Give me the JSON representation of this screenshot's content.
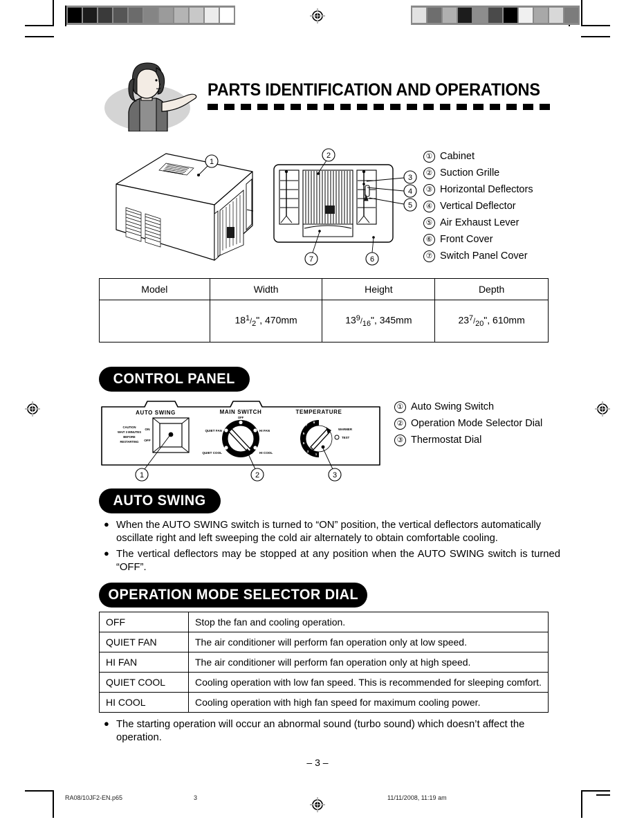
{
  "header": {
    "title": "PARTS IDENTIFICATION AND OPERATIONS",
    "illustration_alt": "woman-pointing-icon"
  },
  "parts_legend": [
    {
      "num": "①",
      "label": "Cabinet"
    },
    {
      "num": "②",
      "label": "Suction Grille"
    },
    {
      "num": "③",
      "label": "Horizontal Deflectors"
    },
    {
      "num": "④",
      "label": "Vertical Deflector"
    },
    {
      "num": "⑤",
      "label": "Air Exhaust Lever"
    },
    {
      "num": "⑥",
      "label": "Front Cover"
    },
    {
      "num": "⑦",
      "label": "Switch Panel Cover"
    }
  ],
  "dimension_table": {
    "headers": [
      "Model",
      "Width",
      "Height",
      "Depth"
    ],
    "row": {
      "model": "",
      "width_whole": "18",
      "width_num": "1",
      "width_den": "2",
      "width_mm": ", 470mm",
      "height_whole": "13",
      "height_num": "9",
      "height_den": "16",
      "height_mm": ", 345mm",
      "depth_whole": "23",
      "depth_num": "7",
      "depth_den": "20",
      "depth_mm": ", 610mm"
    }
  },
  "control_panel": {
    "heading": "CONTROL PANEL",
    "panel_labels": {
      "auto_swing": "AUTO SWING",
      "main_switch": "MAIN SWITCH",
      "temperature": "TEMPERATURE",
      "caution_line1": "CAUTION",
      "caution_line2": "WAIT 3 MINUTES",
      "caution_line3": "BEFORE",
      "caution_line4": "RESTARTING",
      "switch_on": "ON",
      "switch_off": "OFF",
      "main_off": "OFF",
      "main_quiet_fan": "QUIET FAN",
      "main_hi_fan": "HI FAN",
      "main_quiet_cool": "QUIET COOL",
      "main_hi_cool": "HI COOL",
      "temp_warmer": "WARMER",
      "temp_test": "TEST",
      "temp_ticks": [
        "1",
        "3",
        "5",
        "7",
        "9",
        "7",
        "5",
        "3",
        "1"
      ]
    },
    "callouts": [
      "①",
      "②",
      "③"
    ],
    "legend": [
      {
        "num": "①",
        "label": "Auto Swing Switch"
      },
      {
        "num": "②",
        "label": "Operation Mode Selector Dial"
      },
      {
        "num": "③",
        "label": "Thermostat Dial"
      }
    ]
  },
  "auto_swing": {
    "heading": "AUTO SWING",
    "bullets": [
      "When the AUTO SWING switch is turned to “ON” position, the vertical deflectors automatically oscillate right and left sweeping the cold air alternately to obtain comfortable cooling.",
      "The vertical deflectors may be stopped at any position when the AUTO SWING switch is turned “OFF”."
    ]
  },
  "operation_mode": {
    "heading": "OPERATION MODE SELECTOR DIAL",
    "rows": [
      {
        "mode": "OFF",
        "description": "Stop the fan and cooling operation."
      },
      {
        "mode": "QUIET FAN",
        "description": "The air conditioner will perform fan operation only at low speed."
      },
      {
        "mode": "HI FAN",
        "description": "The air conditioner will perform fan operation only at high speed."
      },
      {
        "mode": "QUIET COOL",
        "description": "Cooling operation with low fan speed. This is recommended for sleeping comfort."
      },
      {
        "mode": "HI COOL",
        "description": "Cooling operation with high fan speed for maximum cooling power."
      }
    ],
    "note": "The starting operation will occur an abnormal sound (turbo sound) which doesn’t affect the operation."
  },
  "page_number": "– 3 –",
  "footer": {
    "file": "RA08/10JF2-EN.p65",
    "number": "3",
    "date": "11/11/2008, 11:19 am"
  },
  "calibration": {
    "left_strip": [
      "#000000",
      "#1c1c1c",
      "#3a3a3a",
      "#565656",
      "#6b6b6b",
      "#858585",
      "#9b9b9b",
      "#b4b4b4",
      "#c8c8c8",
      "#ececec",
      "#ffffff"
    ],
    "right_strip": [
      "#e2e2e2",
      "#6e6e6e",
      "#b0b0b0",
      "#1c1c1c",
      "#8d8d8d",
      "#4a4a4a",
      "#000000",
      "#f0f0f0",
      "#a8a8a8",
      "#d8d8d8",
      "#7c7c7c"
    ]
  }
}
